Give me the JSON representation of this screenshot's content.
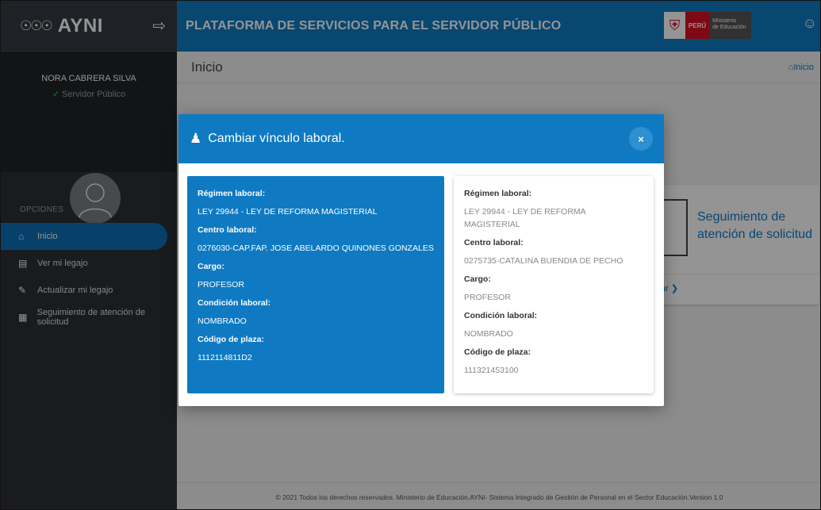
{
  "sidebar": {
    "brand": "AYNI",
    "user_name": "NORA CABRERA SILVA",
    "user_role": "Servidor Público",
    "options_title": "OPCIONES",
    "items": [
      {
        "label": "Inicio",
        "icon": "home-icon"
      },
      {
        "label": "Ver mi legajo",
        "icon": "file-icon"
      },
      {
        "label": "Actualizar mi legajo",
        "icon": "pencil-icon"
      },
      {
        "label": "Seguimiento de atención de solicitud",
        "icon": "list-icon"
      }
    ]
  },
  "header": {
    "title": "PLATAFORMA DE SERVICIOS PARA EL SERVIDOR PÚBLICO",
    "gov_country": "PERÚ",
    "gov_ministry_line1": "Ministerio",
    "gov_ministry_line2": "de Educación"
  },
  "page": {
    "title": "Inicio",
    "breadcrumb": "Inicio",
    "card_title": "Seguimiento de atención de solicitud",
    "card_link": "ar ❯"
  },
  "footer": "© 2021 Todos los derechos reservados. Ministerio de Educación.AYNI- Sistema Integrado de Gestión de Personal en el Sector Educación.Version 1.0",
  "modal": {
    "title": "Cambiar vínculo laboral.",
    "close_label": "×",
    "left": {
      "regimen_label": "Régimen laboral:",
      "regimen_value": "LEY 29944 - LEY DE REFORMA MAGISTERIAL",
      "centro_label": "Centro laboral:",
      "centro_value": "0276030-CAP.FAP. JOSE ABELARDO QUINONES GONZALES",
      "cargo_label": "Cargo:",
      "cargo_value": "PROFESOR",
      "condicion_label": "Condición laboral:",
      "condicion_value": "NOMBRADO",
      "plaza_label": "Código de plaza:",
      "plaza_value": "1112114811D2"
    },
    "right": {
      "regimen_label": "Régimen laboral:",
      "regimen_value": "LEY 29944 - LEY DE REFORMA MAGISTERIAL",
      "centro_label": "Centro laboral:",
      "centro_value": "0275735-CATALINA BUENDIA DE PECHO",
      "cargo_label": "Cargo:",
      "cargo_value": "PROFESOR",
      "condicion_label": "Condición laboral:",
      "condicion_value": "NOMBRADO",
      "plaza_label": "Código de plaza:",
      "plaza_value": "111321453100"
    }
  },
  "colors": {
    "primary": "#0f7ac2",
    "sidebar": "#2b3035",
    "success": "#35c26b"
  }
}
